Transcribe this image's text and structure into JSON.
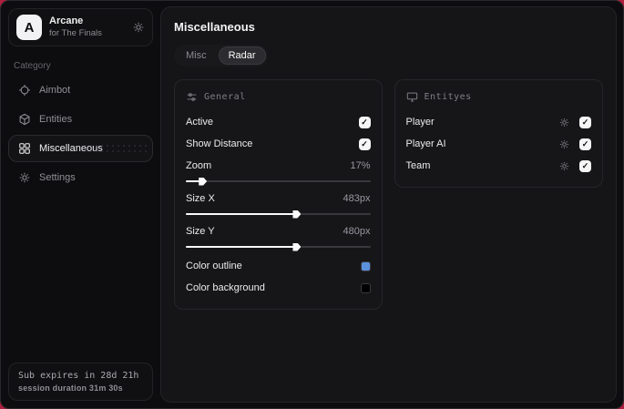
{
  "window": {
    "accent_bg": "#ad1e3e"
  },
  "sidebar": {
    "brand": {
      "initial": "A",
      "title": "Arcane",
      "subtitle": "for The Finals"
    },
    "category_label": "Category",
    "items": [
      {
        "label": "Aimbot",
        "selected": false
      },
      {
        "label": "Entities",
        "selected": false
      },
      {
        "label": "Miscellaneous",
        "selected": true
      },
      {
        "label": "Settings",
        "selected": false
      }
    ],
    "footer": {
      "line1": "Sub expires in 28d 21h",
      "line2": "session duration 31m 30s"
    }
  },
  "main": {
    "title": "Miscellaneous",
    "tabs": [
      {
        "label": "Misc",
        "active": false
      },
      {
        "label": "Radar",
        "active": true
      }
    ],
    "check_glyph": "✓",
    "general": {
      "title": "General",
      "toggles": [
        {
          "label": "Active",
          "checked": true
        },
        {
          "label": "Show Distance",
          "checked": true
        }
      ],
      "sliders": [
        {
          "label": "Zoom",
          "value": "17%",
          "percent": 8
        },
        {
          "label": "Size X",
          "value": "483px",
          "percent": 59
        },
        {
          "label": "Size Y",
          "value": "480px",
          "percent": 59
        }
      ],
      "colors": [
        {
          "label": "Color outline",
          "color": "#5b90dc"
        },
        {
          "label": "Color background",
          "color": "#000000"
        }
      ]
    },
    "entities": {
      "title": "Entityes",
      "rows": [
        {
          "label": "Player",
          "checked": true
        },
        {
          "label": "Player AI",
          "checked": true
        },
        {
          "label": "Team",
          "checked": true
        }
      ]
    }
  }
}
